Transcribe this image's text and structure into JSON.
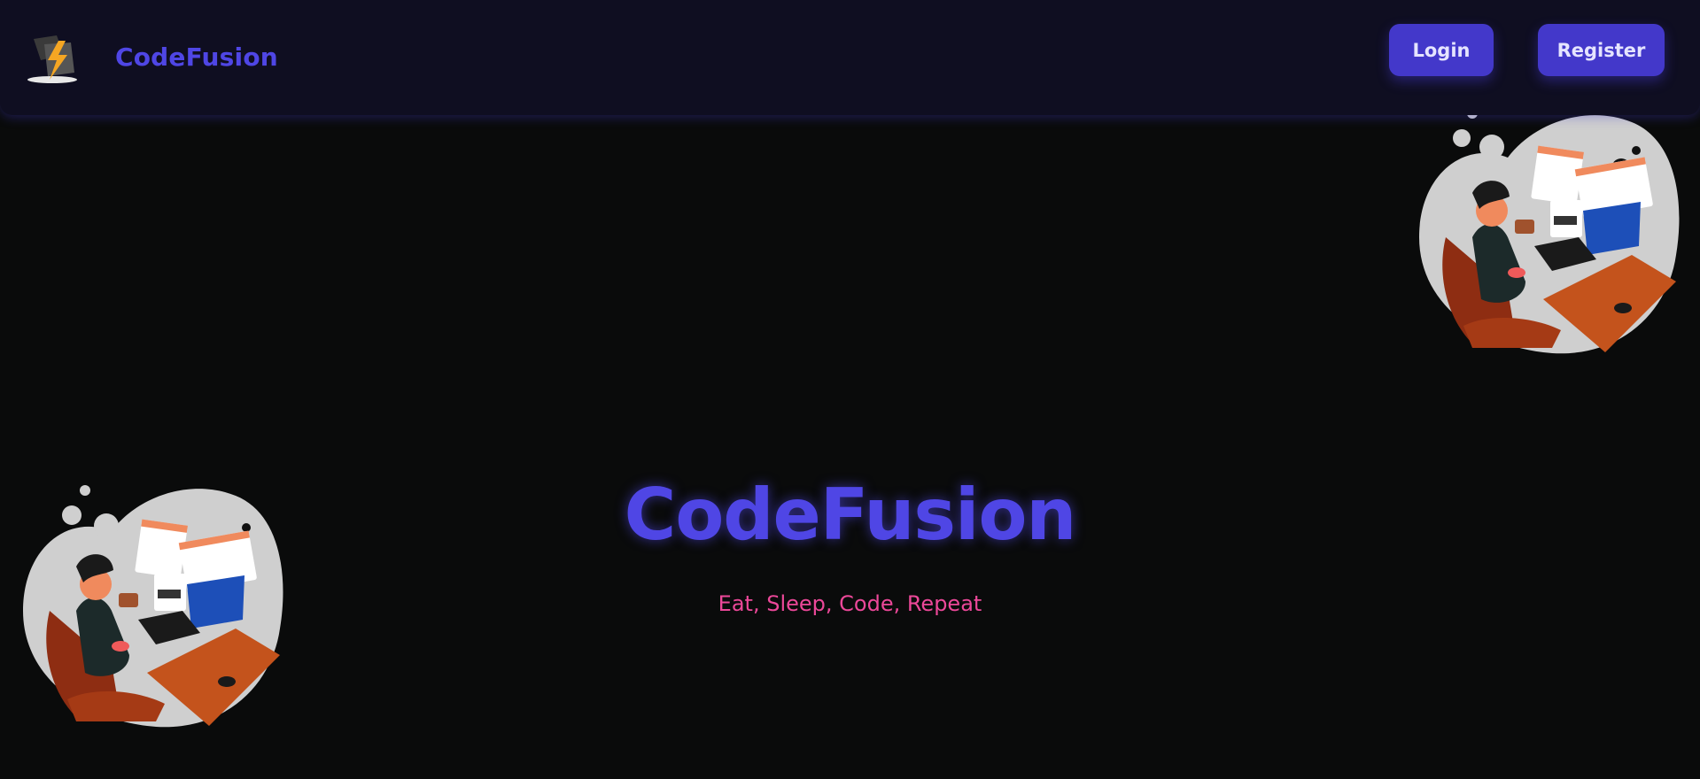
{
  "navbar": {
    "brand": "CodeFusion",
    "logo_icon": "lightning-logo-icon",
    "login_label": "Login",
    "register_label": "Register"
  },
  "hero": {
    "title": "CodeFusion",
    "tagline": "Eat, Sleep, Code, Repeat"
  },
  "illustrations": [
    {
      "icon": "developer-at-desk-illustration"
    },
    {
      "icon": "developer-at-desk-illustration"
    }
  ],
  "colors": {
    "background": "#0a0b0b",
    "navbar_bg": "#0f0e21",
    "accent": "#4f46e5",
    "button": "#4338ca",
    "tagline": "#ec4899"
  }
}
